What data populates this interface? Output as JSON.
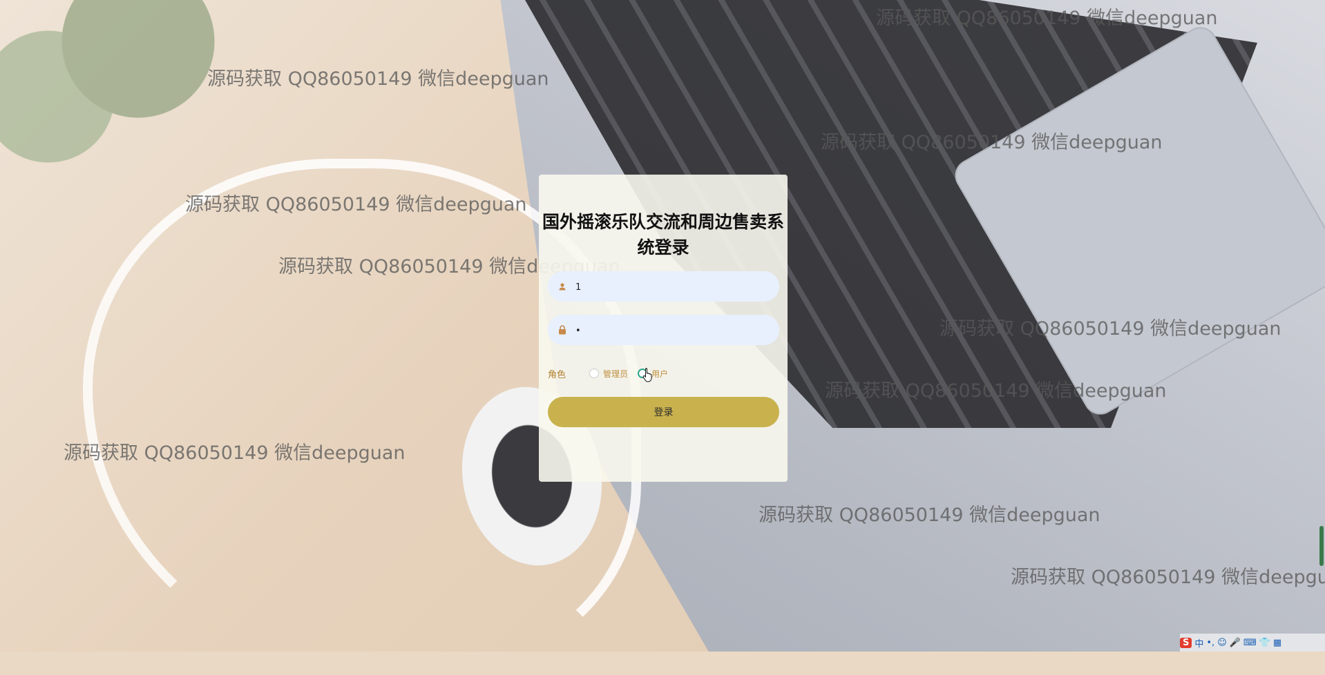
{
  "watermark": "源码获取 QQ86050149 微信deepguan",
  "login": {
    "title": "国外摇滚乐队交流和周边售卖系统登录",
    "username_value": "1",
    "password_value": "•",
    "role_label": "角色",
    "roles": [
      "管理员",
      "用户"
    ],
    "selected_role": "用户",
    "submit_label": "登录"
  },
  "tray": {
    "ime_logo": "S",
    "ime_mode": "中"
  },
  "colors": {
    "button": "#c9b24d",
    "input_bg": "#e8f0fe",
    "role_text": "#b08030",
    "radio_selected": "#30a38a"
  }
}
